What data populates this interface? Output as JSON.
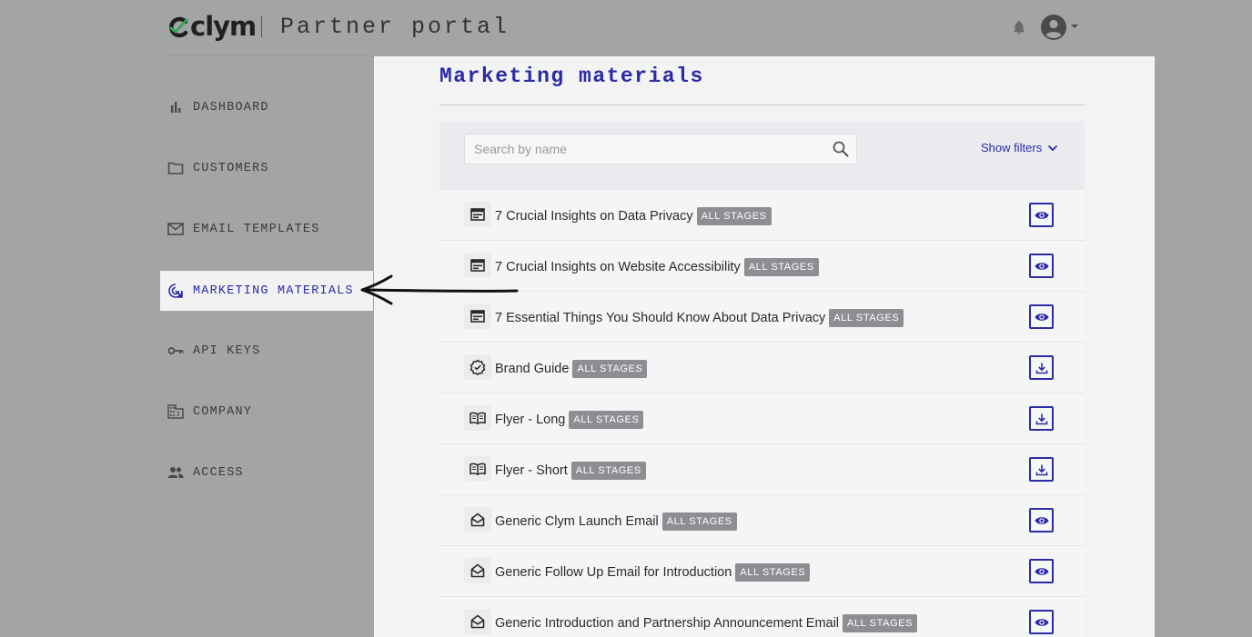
{
  "header": {
    "logo_text": "clym",
    "portal_title": "Partner portal",
    "icons": {
      "notifications": "bell-icon",
      "account": "account-circle-icon",
      "account_menu": "caret-down-icon"
    }
  },
  "sidebar": {
    "items": [
      {
        "label": "DASHBOARD",
        "icon": "bar-chart-icon",
        "active": false
      },
      {
        "label": "CUSTOMERS",
        "icon": "folder-icon",
        "active": false
      },
      {
        "label": "EMAIL TEMPLATES",
        "icon": "mail-icon",
        "active": false
      },
      {
        "label": "MARKETING MATERIALS",
        "icon": "target-cursor-icon",
        "active": true
      },
      {
        "label": "API KEYS",
        "icon": "key-icon",
        "active": false
      },
      {
        "label": "COMPANY",
        "icon": "building-icon",
        "active": false
      },
      {
        "label": "ACCESS",
        "icon": "people-icon",
        "active": false
      }
    ]
  },
  "main": {
    "title": "Marketing materials",
    "search": {
      "placeholder": "Search by name",
      "value": ""
    },
    "filters_label": "Show filters",
    "rows": [
      {
        "title": "7 Crucial Insights on Data Privacy",
        "badge": "ALL STAGES",
        "type_icon": "article-icon",
        "action": "preview",
        "action_icon": "eye-icon"
      },
      {
        "title": "7 Crucial Insights on Website Accessibility",
        "badge": "ALL STAGES",
        "type_icon": "article-icon",
        "action": "preview",
        "action_icon": "eye-icon"
      },
      {
        "title": "7 Essential Things You Should Know About Data Privacy",
        "badge": "ALL STAGES",
        "type_icon": "article-icon",
        "action": "preview",
        "action_icon": "eye-icon"
      },
      {
        "title": "Brand Guide",
        "badge": "ALL STAGES",
        "type_icon": "verified-badge-icon",
        "action": "download",
        "action_icon": "download-icon"
      },
      {
        "title": "Flyer - Long",
        "badge": "ALL STAGES",
        "type_icon": "book-open-icon",
        "action": "download",
        "action_icon": "download-icon"
      },
      {
        "title": "Flyer - Short",
        "badge": "ALL STAGES",
        "type_icon": "book-open-icon",
        "action": "download",
        "action_icon": "download-icon"
      },
      {
        "title": "Generic Clym Launch Email",
        "badge": "ALL STAGES",
        "type_icon": "drafts-icon",
        "action": "preview",
        "action_icon": "eye-icon"
      },
      {
        "title": "Generic Follow Up Email for Introduction",
        "badge": "ALL STAGES",
        "type_icon": "drafts-icon",
        "action": "preview",
        "action_icon": "eye-icon"
      },
      {
        "title": "Generic Introduction and Partnership Announcement Email",
        "badge": "ALL STAGES",
        "type_icon": "drafts-icon",
        "action": "preview",
        "action_icon": "eye-icon"
      }
    ]
  },
  "colors": {
    "accent": "#2b2ba8",
    "badge": "#8c8e93",
    "background": "#a3a4a6"
  }
}
